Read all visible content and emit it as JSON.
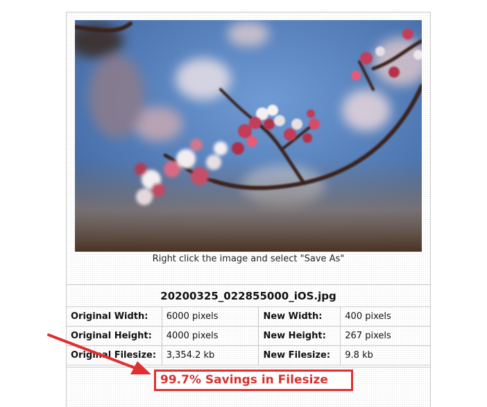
{
  "preview": {
    "caption": "Right click the image and select \"Save As\""
  },
  "file": {
    "name": "20200325_022855000_iOS.jpg"
  },
  "stats": {
    "original_width_label": "Original Width:",
    "original_width_value": "6000 pixels",
    "new_width_label": "New Width:",
    "new_width_value": "400 pixels",
    "original_height_label": "Original Height:",
    "original_height_value": "4000 pixels",
    "new_height_label": "New Height:",
    "new_height_value": "267 pixels",
    "original_filesize_label": "Original Filesize:",
    "original_filesize_value": "3,354.2 kb",
    "new_filesize_label": "New Filesize:",
    "new_filesize_value": "9.8 kb"
  },
  "savings": {
    "text": "99.7% Savings in Filesize"
  },
  "colors": {
    "highlight": "#e02f2f",
    "border": "#c9c9c9"
  }
}
